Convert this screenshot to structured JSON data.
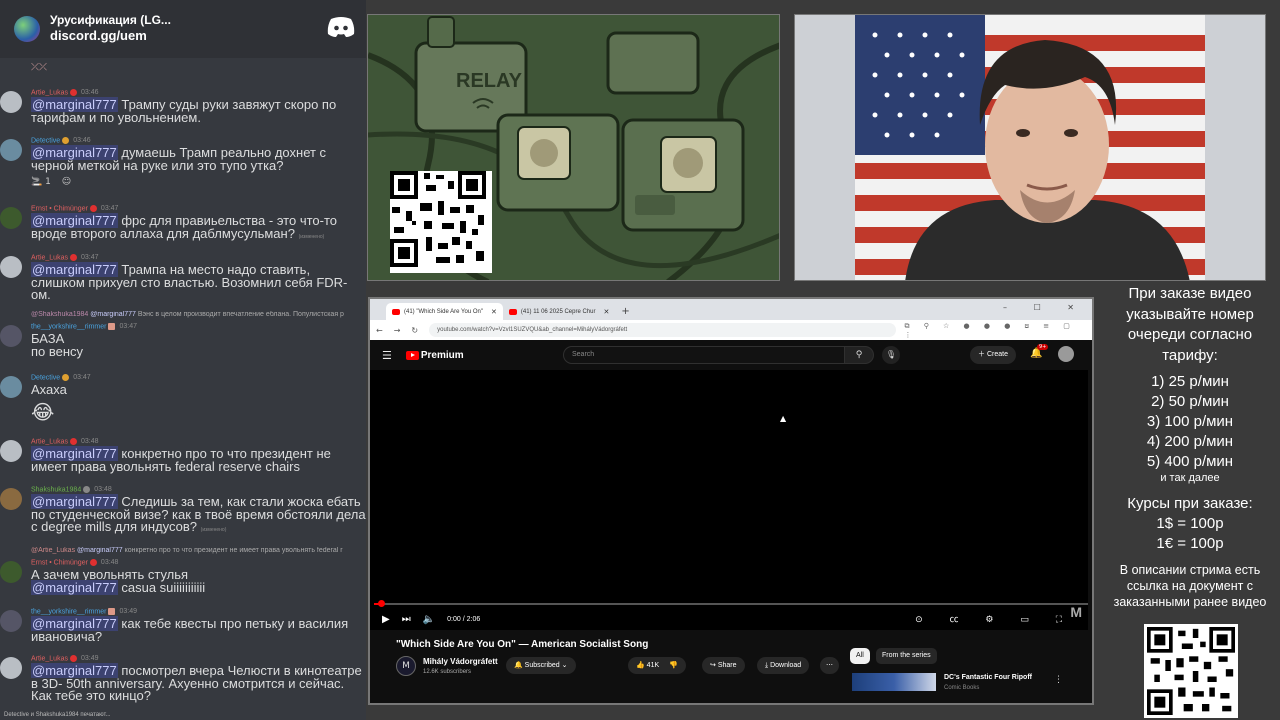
{
  "discord": {
    "server_name": "Урусификация (LG...",
    "server_link": "discord.gg/uem",
    "messages": [
      {
        "user": "Artie_Lukas",
        "time": "03:46",
        "mention": "@marginal777",
        "text": " Трампу суды руки завяжут скоро по тарифам и по увольнением."
      },
      {
        "user": "Detective",
        "time": "03:46",
        "mention": "@marginal777",
        "text": " думаешь Трамп реально дохнет с черной меткой на руке или это тупо утка?",
        "reaction_count": "1"
      },
      {
        "user": "Ernst • Chimünger",
        "time": "03:47",
        "mention": "@marginal777",
        "text": " фрс для правиьельства - это что-то вроде второго аллаха для даблмусульман?",
        "edited": "(изменено)"
      },
      {
        "user": "Artie_Lukas",
        "time": "03:47",
        "mention": "@marginal777",
        "text": " Трампа на место надо ставить, слишком прихуел сто властью. Возомнил себя FDR-ом."
      },
      {
        "reply_user": "@Shakshuka1984",
        "reply_mention": "@marginal777",
        "reply_text": " Вэнс в целом производит впечатление еблана. Популистская р",
        "user": "the__yorkshire__rimmer",
        "time": "03:47",
        "text": "БАЗА\nпо венсу"
      },
      {
        "user": "Detective",
        "time": "03:47",
        "text": "Ахаха",
        "emoji": "😂"
      },
      {
        "user": "Artie_Lukas",
        "time": "03:48",
        "mention": "@marginal777",
        "text": " конкретно про то что президент не имеет права увольнять federal reserve chairs"
      },
      {
        "user": "Shakshuka1984",
        "time": "03:48",
        "mention": "@marginal777",
        "text": " Следишь за тем, как стали жоска ебать по студенческой визе? как в твоё время обстояли дела с degree mills для индусов?",
        "edited": "(изменено)"
      },
      {
        "reply_user": "@Artie_Lukas",
        "reply_mention": "@marginal777",
        "reply_text": " конкретно про то что президент не имеет права увольнять federal r",
        "user": "Ernst • Chimünger",
        "time": "03:48",
        "text": "А зачем увольнять стулья",
        "mention2": "@marginal777",
        "text2": " casua suiiiiiiiiiii"
      },
      {
        "user": "the__yorkshire__rimmer",
        "time": "03:49",
        "mention": "@marginal777",
        "text": " как тебе квесты про петьку и василия ивановича?"
      },
      {
        "user": "Artie_Lukas",
        "time": "03:49",
        "mention": "@marginal777",
        "text": " посмотрел вчера Челюсти в кинотеатре в 3D- 50th anniversary. Ахуенно смотрится и сейчас. Как тебе это кинцо?"
      }
    ],
    "typing": "Detective и Shakshuka1984 печатают..."
  },
  "art": {
    "relay_label": "RELAY"
  },
  "browser": {
    "tab1": "(41) \"Which Side Are You On\"",
    "tab2": "(41) 11 06 2025 Cepre Chur",
    "url": "youtube.com/watch?v=Vzvl1SUZVQU&ab_channel=MihályVádorgráfett",
    "logo": "Premium",
    "search_placeholder": "Search",
    "create": "Create",
    "notif_count": "9+",
    "time": "0:00 / 2:06",
    "progress_fraction": 0.01,
    "watermark": "M",
    "title": "\"Which Side Are You On\" — American Socialist Song",
    "channel": "Mihály Vádorgráfett",
    "channel_initial": "M",
    "subscribers": "12.6K subscribers",
    "subscribed": "Subscribed",
    "likes": "41K",
    "share": "Share",
    "download": "Download",
    "chip_all": "All",
    "chip_series": "From the series",
    "related_title": "DC's Fantastic Four Ripoff",
    "related_channel": "Comic Books"
  },
  "info": {
    "heading": "При заказе видео указывайте номер очереди согласно тарифу:",
    "prices": [
      "1) 25 р/мин",
      "2) 50 р/мин",
      "3) 100 р/мин",
      "4) 200 р/мин",
      "5) 400 р/мин"
    ],
    "etc": "и так далее",
    "rates_heading": "Курсы при заказе:",
    "rates": [
      "1$ = 100р",
      "1€ = 100р"
    ],
    "note": "В описании стрима есть ссылка на документ с заказанными ранее видео"
  },
  "colors": {
    "mention_bg": "#3c4270",
    "youtube_red": "#ff0000",
    "discord_bg": "#36393f"
  }
}
